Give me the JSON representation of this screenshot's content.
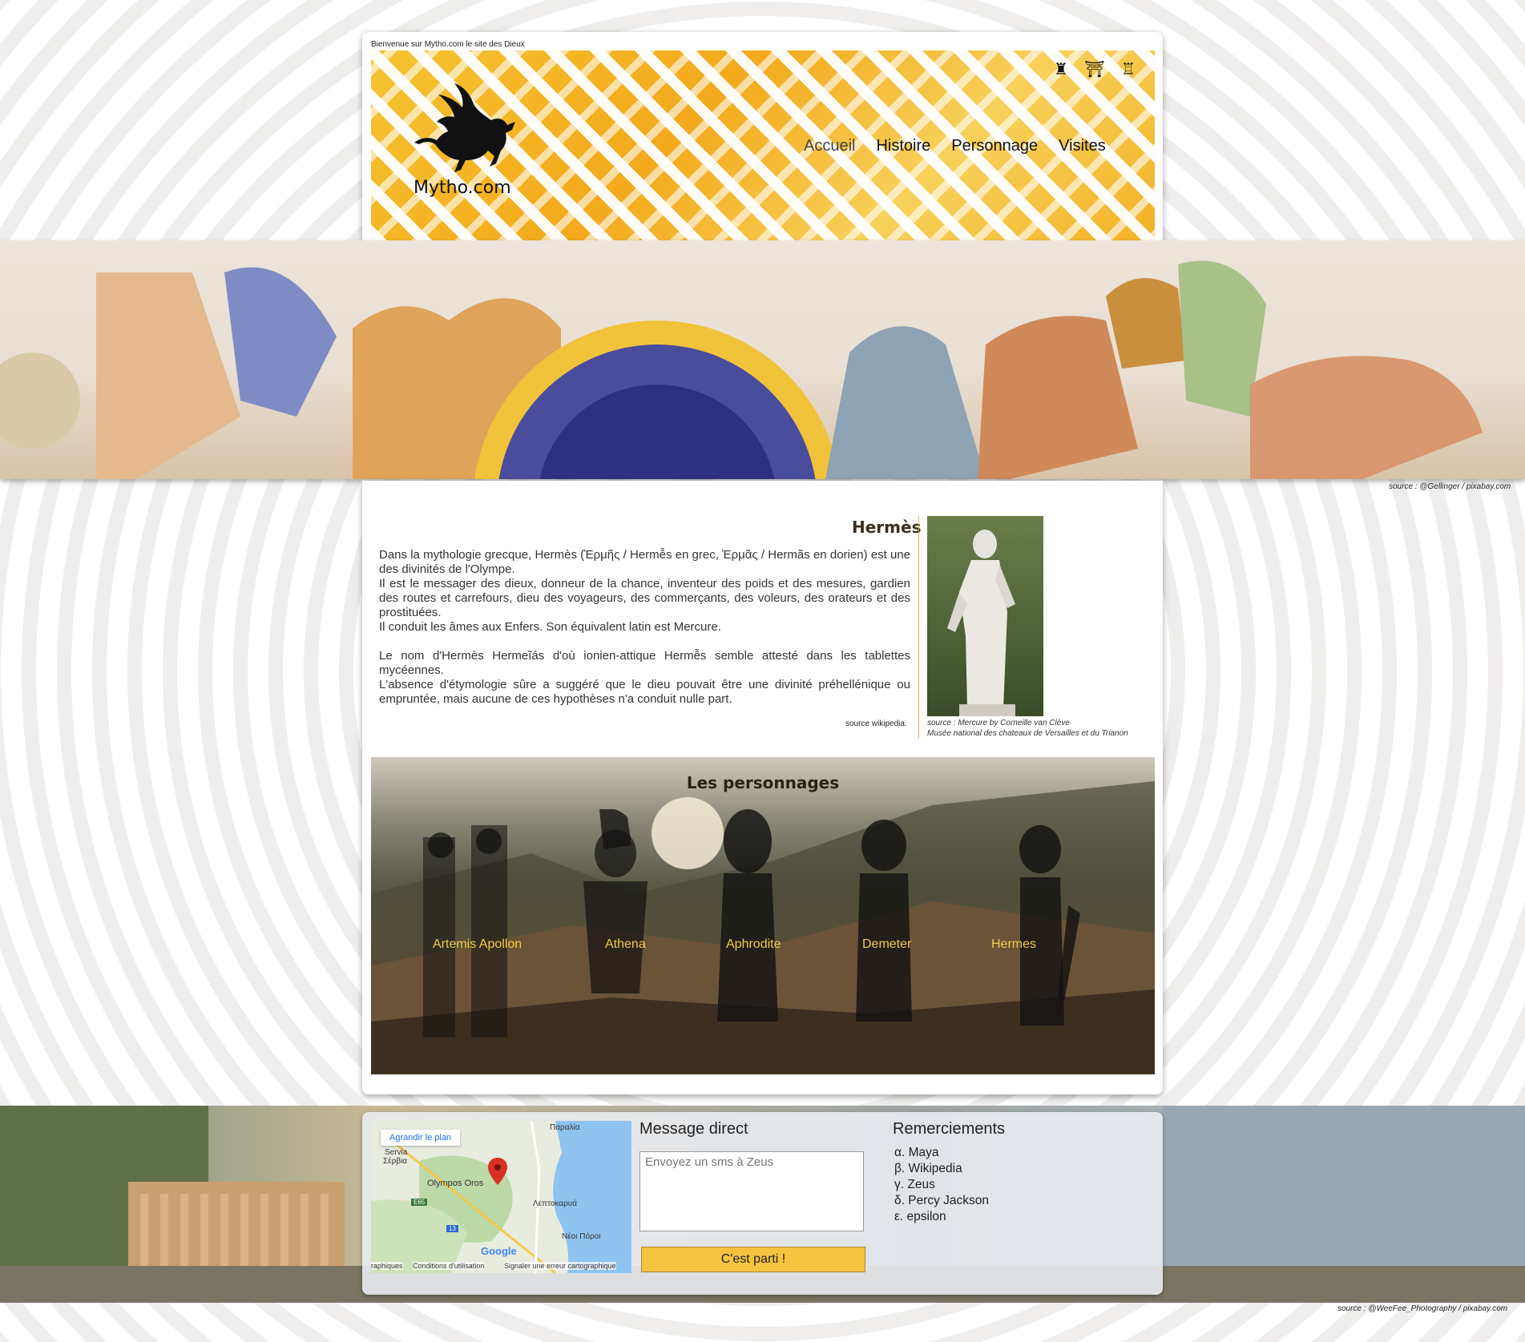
{
  "header": {
    "welcome": "Bienvenue sur Mytho.com le site des Dieux",
    "logo_text": "Mytho.com",
    "icons": [
      "castle-icon",
      "pagoda-icon",
      "rook-icon"
    ],
    "nav": [
      "Accueil",
      "Histoire",
      "Personnage",
      "Visites"
    ]
  },
  "banner": {
    "credit": "source : @Gellinger / pixabay.com"
  },
  "article": {
    "title": "Hermès",
    "p1": "Dans la mythologie grecque, Hermès (Ἑρμῆς / Hermễs en grec, Ἑρμᾶς / Hermãs en dorien) est une des divinités de l'Olympe.",
    "p2": "Il est le messager des dieux, donneur de la chance, inventeur des poids et des mesures, gardien des routes et carrefours, dieu des voyageurs, des commerçants, des voleurs, des orateurs et des prostituées.",
    "p3": "Il conduit les âmes aux Enfers. Son équivalent latin est Mercure.",
    "p4": "Le nom d'Hermès Hermeĩás d'où ionien-attique Hermễs semble attesté dans les tablettes mycéennes.",
    "p5": "L'absence d'étymologie sûre a suggéré que le dieu pouvait être une divinité préhellénique ou empruntée, mais aucune de ces hypothèses n'a conduit nulle part.",
    "source": "source wikipedia.",
    "image_caption_1": "source : Mercure by Corneille van Clève",
    "image_caption_2": "Musée national des chateaux de Versailles et du Trianon"
  },
  "personnages": {
    "title": "Les personnages",
    "items": [
      "Artemis Apollon",
      "Athena",
      "Aphrodite",
      "Demeter",
      "Hermes"
    ]
  },
  "footer": {
    "map": {
      "enlarge_button": "Agrandir le plan",
      "labels": [
        "Παραλία",
        "Servia",
        "Σέρβια",
        "Olympos Oros",
        "Λεπτοκαρυά",
        "Νέοι Πόροι",
        "E65",
        "13"
      ],
      "logo": "Google",
      "terms": "Conditions d'utilisation",
      "report": "Signaler une erreur cartographique",
      "data_label": "raphiques"
    },
    "message": {
      "title": "Message direct",
      "placeholder": "Envoyez un sms à Zeus",
      "button": "C'est parti !"
    },
    "thanks": {
      "title": "Remerciements",
      "items": [
        "α. Maya",
        "β. Wikipedia",
        "γ. Zeus",
        "δ. Percy Jackson",
        "ε. epsilon"
      ]
    },
    "credit": "source : @WeeFee_Photography / pixabay.com"
  },
  "colors": {
    "accent": "#f6c340",
    "perso_label": "#f1cc47",
    "title_brown": "#3a2f1c",
    "map_pin": "#d93025"
  }
}
